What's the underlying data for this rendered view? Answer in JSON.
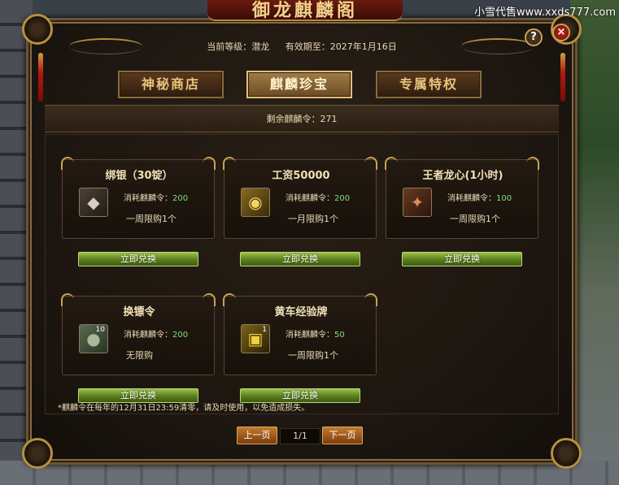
{
  "watermark": "小雪代售www.xxds777.com",
  "banner": {
    "title": "御龙麒麟阁"
  },
  "header": {
    "level_label": "当前等级：潜龙",
    "expiry_label": "有效期至：2027年1月16日"
  },
  "controls": {
    "help": "?",
    "close": "×"
  },
  "tabs": [
    {
      "label": "神秘商店",
      "active": false
    },
    {
      "label": "麒麟珍宝",
      "active": true
    },
    {
      "label": "专属特权",
      "active": false
    }
  ],
  "remaining": {
    "text": "剩余麒麟令：271"
  },
  "items": [
    {
      "title": "绑银（30锭）",
      "icon": "silver-ingot-icon",
      "icon_glyph": "◆",
      "icon_count": "",
      "cost_label": "消耗麒麟令：",
      "cost_value": "200",
      "limit": "一周限购1个",
      "button": "立即兑换"
    },
    {
      "title": "工资50000",
      "icon": "salary-gold-icon",
      "icon_glyph": "◉",
      "icon_count": "",
      "cost_label": "消耗麒麟令：",
      "cost_value": "200",
      "limit": "一月限购1个",
      "button": "立即兑换"
    },
    {
      "title": "王者龙心(1小时)",
      "icon": "dragon-heart-icon",
      "icon_glyph": "✦",
      "icon_count": "",
      "cost_label": "消耗麒麟令：",
      "cost_value": "100",
      "limit": "一周限购1个",
      "button": "立即兑换"
    },
    {
      "title": "换镖令",
      "icon": "escort-token-icon",
      "icon_glyph": "●",
      "icon_count": "10",
      "cost_label": "消耗麒麟令：",
      "cost_value": "200",
      "limit": "无限购",
      "button": "立即兑换"
    },
    {
      "title": "黄车经验牌",
      "icon": "yellow-cart-exp-icon",
      "icon_glyph": "▣",
      "icon_count": "1",
      "cost_label": "消耗麒麟令：",
      "cost_value": "50",
      "limit": "一周限购1个",
      "button": "立即兑换"
    }
  ],
  "note": "*麒麟令在每年的12月31日23:59清零，请及时使用，以免造成损失。",
  "pagination": {
    "prev": "上一页",
    "page": "1/1",
    "next": "下一页"
  },
  "colors": {
    "accent_gold": "#c9a255",
    "cost_green": "#7fe07a",
    "button_green": "#5a7d1e",
    "pager_orange": "#c27a2e"
  }
}
